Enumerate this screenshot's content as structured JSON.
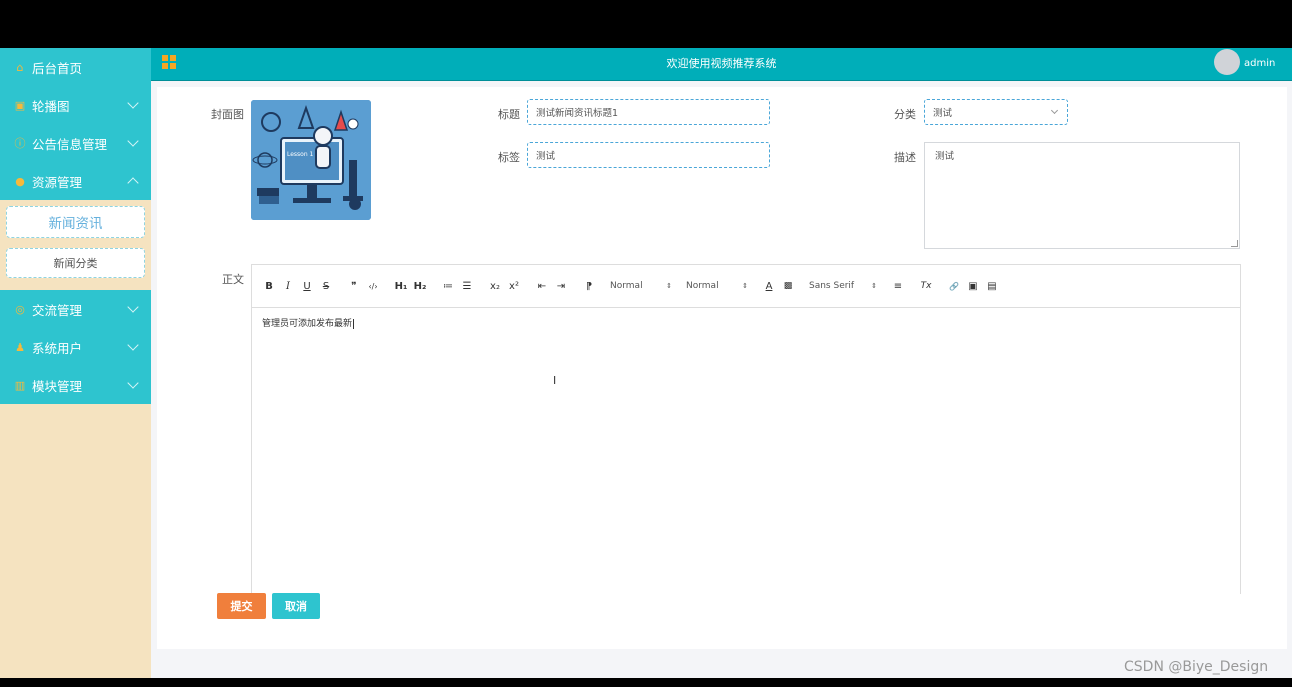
{
  "sidebar": {
    "items": [
      {
        "label": "后台首页",
        "icon": "home-icon"
      },
      {
        "label": "轮播图",
        "icon": "image-icon"
      },
      {
        "label": "公告信息管理",
        "icon": "info-icon"
      },
      {
        "label": "资源管理",
        "icon": "pin-icon"
      },
      {
        "label": "交流管理",
        "icon": "chat-icon"
      },
      {
        "label": "系统用户",
        "icon": "user-icon"
      },
      {
        "label": "模块管理",
        "icon": "module-icon"
      }
    ],
    "submenu": [
      {
        "label": "新闻资讯"
      },
      {
        "label": "新闻分类"
      }
    ]
  },
  "header": {
    "title": "欢迎使用视频推荐系统",
    "username": "admin"
  },
  "form": {
    "cover_label": "封面图",
    "cover_text": "Lesson 1",
    "title_label": "标题",
    "title_value": "测试新闻资讯标题1",
    "category_label": "分类",
    "category_value": "测试",
    "tags_label": "标签",
    "tags_value": "测试",
    "desc_label": "描述",
    "desc_value": "测试",
    "body_label": "正文",
    "body_value": "管理员可添加发布最新"
  },
  "toolbar": {
    "bold": "B",
    "italic": "I",
    "underline": "U",
    "strike": "S",
    "blockquote": "❞",
    "code": "‹/›",
    "h1": "H₁",
    "h2": "H₂",
    "ordered_list": "≔",
    "bullet_list": "☰",
    "subscript": "x₂",
    "superscript": "x²",
    "outdent": "⇤",
    "indent": "⇥",
    "direction": "⁋",
    "size_select": "Normal",
    "header_select": "Normal",
    "color": "A",
    "background": "▩",
    "font_select": "Sans Serif",
    "align": "≡",
    "clean": "Tx",
    "link": "🔗",
    "image": "▣",
    "video": "▤"
  },
  "buttons": {
    "submit": "提交",
    "cancel": "取消"
  },
  "colors": {
    "sidebar_teal": "#2ec4cf",
    "header_teal": "#00aeb9",
    "submit_orange": "#f07f3c",
    "cancel_teal": "#2ec4cf",
    "sidebar_bg": "#f5e3c0"
  },
  "watermark": "CSDN @Biye_Design"
}
